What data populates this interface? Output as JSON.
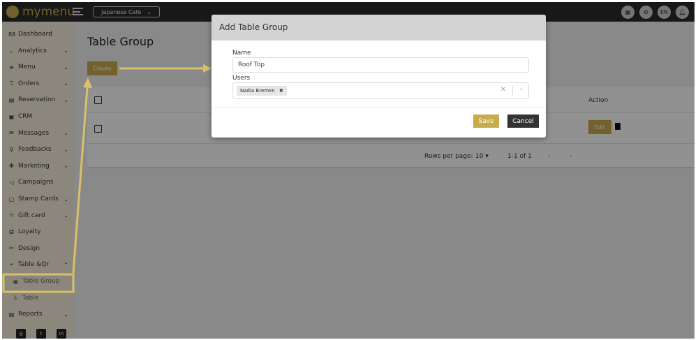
{
  "brand": "mymenu",
  "store_selector": "Japanese Cafe",
  "top_icons": [
    "apps-icon",
    "settings-icon",
    "EN",
    "bell-icon"
  ],
  "sidebar": {
    "items": [
      {
        "label": "Dashboard",
        "icon": "88",
        "chev": false
      },
      {
        "label": "Analytics",
        "icon": "⌞",
        "chev": true
      },
      {
        "label": "Menu",
        "icon": "≡",
        "chev": true
      },
      {
        "label": "Orders",
        "icon": "♖",
        "chev": true
      },
      {
        "label": "Reservation",
        "icon": "▤",
        "chev": true
      },
      {
        "label": "CRM",
        "icon": "▣",
        "chev": false
      },
      {
        "label": "Messages",
        "icon": "✉",
        "chev": true
      },
      {
        "label": "Feedbacks",
        "icon": "⚲",
        "chev": true
      },
      {
        "label": "Marketing",
        "icon": "✤",
        "chev": true
      },
      {
        "label": "Campaigns",
        "icon": "◁",
        "chev": false
      },
      {
        "label": "Stamp Cards",
        "icon": "▢",
        "chev": true
      },
      {
        "label": "Gift card",
        "icon": "⊓",
        "chev": true
      },
      {
        "label": "Loyalty",
        "icon": "✪",
        "chev": false
      },
      {
        "label": "Design",
        "icon": "✂",
        "chev": false
      },
      {
        "label": "Table &Qr",
        "icon": "⌖",
        "chev": true
      }
    ],
    "sub_items": [
      {
        "label": "Table Group",
        "icon": "▣"
      },
      {
        "label": "Table",
        "icon": "♿"
      }
    ],
    "reports": "Reports",
    "social": [
      "instagram-icon",
      "twitter-icon",
      "linkedin-icon"
    ]
  },
  "main": {
    "title": "Table Group",
    "create": "Create",
    "action_header": "Action",
    "edit": "Edit",
    "pagination": {
      "rows_label": "Rows per page:",
      "rows_value": "10",
      "range": "1-1 of 1"
    }
  },
  "modal": {
    "title": "Add Table Group",
    "name_label": "Name",
    "name_value": "Roof Top",
    "users_label": "Users",
    "user_chip": "Nadia Bremen",
    "save": "Save",
    "cancel": "Cancel"
  },
  "colors": {
    "accent": "#c8ab4a",
    "annotation": "#d9c06a",
    "topbar": "#2b2b2b"
  }
}
